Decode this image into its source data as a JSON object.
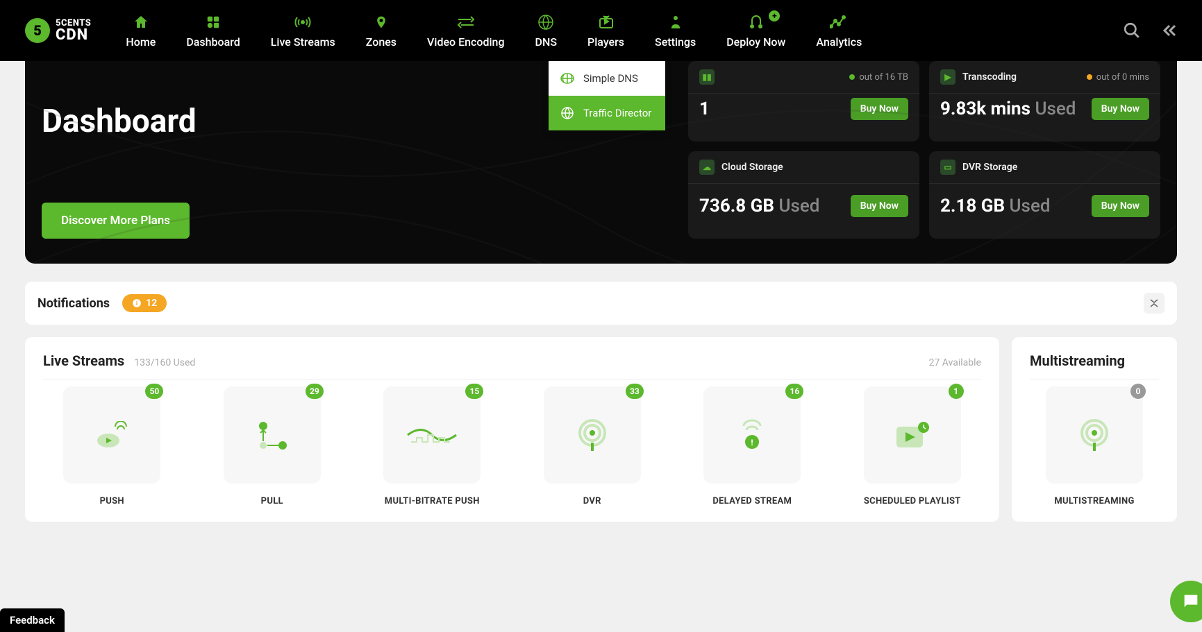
{
  "brand": {
    "badge": "5",
    "line1": "5CENTS",
    "line2": "CDN"
  },
  "nav": {
    "home": "Home",
    "dashboard": "Dashboard",
    "livestreams": "Live Streams",
    "zones": "Zones",
    "encoding": "Video Encoding",
    "dns": "DNS",
    "players": "Players",
    "settings": "Settings",
    "deploy": "Deploy Now",
    "analytics": "Analytics"
  },
  "dns_dropdown": {
    "simple": "Simple DNS",
    "traffic": "Traffic Director"
  },
  "hero": {
    "title": "Dashboard",
    "discover": "Discover More Plans"
  },
  "stats": {
    "bandwidth": {
      "title": "",
      "quota": "out of 16 TB",
      "value": "1",
      "used": "",
      "buy": "Buy Now",
      "dot": "#5cb82c"
    },
    "transcoding": {
      "title": "Transcoding",
      "quota": "out of 0 mins",
      "value": "9.83k mins",
      "used": "Used",
      "buy": "Buy Now",
      "dot": "#f5a623"
    },
    "cloud": {
      "title": "Cloud Storage",
      "value": "736.8 GB",
      "used": "Used",
      "buy": "Buy Now"
    },
    "dvr": {
      "title": "DVR Storage",
      "value": "2.18 GB",
      "used": "Used",
      "buy": "Buy Now"
    }
  },
  "notifications": {
    "title": "Notifications",
    "count": "12"
  },
  "livestreams": {
    "title": "Live Streams",
    "usage": "133/160 Used",
    "available": "27 Available",
    "tiles": {
      "push": {
        "label": "PUSH",
        "count": "50"
      },
      "pull": {
        "label": "PULL",
        "count": "29"
      },
      "mbr": {
        "label": "MULTI-BITRATE PUSH",
        "count": "15"
      },
      "dvr": {
        "label": "DVR",
        "count": "33"
      },
      "delayed": {
        "label": "DELAYED STREAM",
        "count": "16"
      },
      "scheduled": {
        "label": "SCHEDULED PLAYLIST",
        "count": "1"
      }
    }
  },
  "multistreaming": {
    "title": "Multistreaming",
    "tile": {
      "label": "MULTISTREAMING",
      "count": "0"
    }
  },
  "feedback": "Feedback"
}
